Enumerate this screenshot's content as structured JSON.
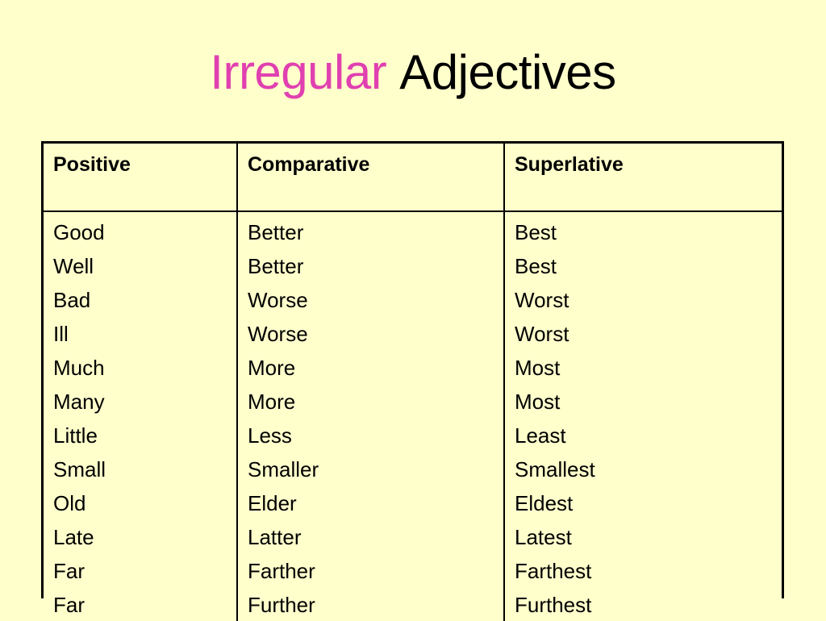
{
  "slide": {
    "background_color": "#FFFFCC",
    "title": {
      "part1": "Irregular",
      "part1_color": "#E040B0",
      "part2": "Adjectives",
      "part2_color": "#000000"
    }
  },
  "table": {
    "border_color": "#000000",
    "headers": [
      "Positive",
      "Comparative",
      "Superlative"
    ],
    "rows": [
      {
        "positive": "Good",
        "positive_bold": false,
        "comparative": "Better",
        "comparative_bold": false,
        "superlative": "Best",
        "superlative_bold": false
      },
      {
        "positive": "Well",
        "positive_bold": false,
        "comparative": "Better",
        "comparative_bold": false,
        "superlative": "Best",
        "superlative_bold": false
      },
      {
        "positive": "Bad",
        "positive_bold": false,
        "comparative": "Worse",
        "comparative_bold": false,
        "superlative": "Worst",
        "superlative_bold": false
      },
      {
        "positive": "Ill",
        "positive_bold": false,
        "comparative": "Worse",
        "comparative_bold": false,
        "superlative": "Worst",
        "superlative_bold": false
      },
      {
        "positive": "Much",
        "positive_bold": false,
        "comparative": "More",
        "comparative_bold": false,
        "superlative": "Most",
        "superlative_bold": false
      },
      {
        "positive": "Many",
        "positive_bold": false,
        "comparative": "More",
        "comparative_bold": false,
        "superlative": "Most",
        "superlative_bold": false
      },
      {
        "positive": "Little",
        "positive_bold": false,
        "comparative": "Less",
        "comparative_bold": true,
        "superlative": "Least",
        "superlative_bold": true
      },
      {
        "positive": "Small",
        "positive_bold": false,
        "comparative": "Smaller",
        "comparative_bold": false,
        "superlative": "Smallest",
        "superlative_bold": false
      },
      {
        "positive": "Old",
        "positive_bold": false,
        "comparative": "Elder",
        "comparative_bold": false,
        "superlative": "Eldest",
        "superlative_bold": false
      },
      {
        "positive": "Late",
        "positive_bold": true,
        "comparative": "Latter",
        "comparative_bold": true,
        "superlative": "Latest",
        "superlative_bold": true
      },
      {
        "positive": "Far",
        "positive_bold": false,
        "comparative": "Farther",
        "comparative_bold": false,
        "superlative": "Farthest",
        "superlative_bold": false
      },
      {
        "positive": "Far",
        "positive_bold": false,
        "comparative": "Further",
        "comparative_bold": false,
        "superlative": "Furthest",
        "superlative_bold": false
      }
    ]
  }
}
